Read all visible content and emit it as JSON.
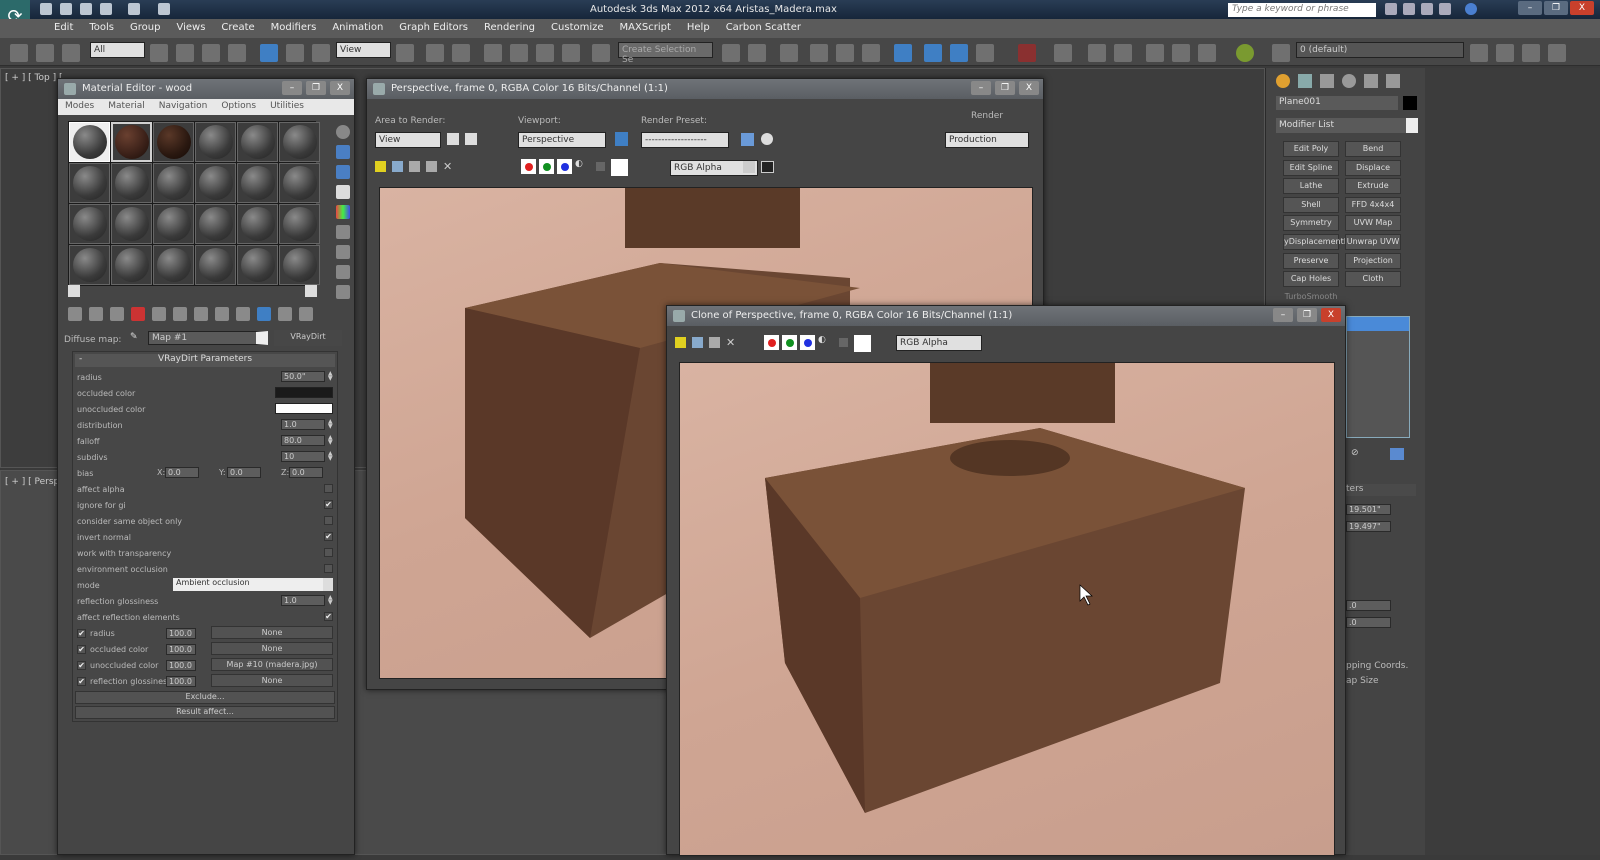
{
  "app": {
    "title": "Autodesk 3ds Max  2012 x64    Aristas_Madera.max",
    "search_placeholder": "Type a keyword or phrase",
    "minimize": "–",
    "restore": "❐",
    "close": "X"
  },
  "menu": [
    "Edit",
    "Tools",
    "Group",
    "Views",
    "Create",
    "Modifiers",
    "Animation",
    "Graph Editors",
    "Rendering",
    "Customize",
    "MAXScript",
    "Help",
    "Carbon Scatter"
  ],
  "toolbar": {
    "selection_filter": "All",
    "ref_coord": "View",
    "named_selection": "Create Selection Se",
    "layer": "0 (default)"
  },
  "viewports": {
    "top_label": "[ + ] [ Top ] [",
    "persp_label": "[ + ] [ Perspe"
  },
  "material_editor": {
    "title": "Material Editor - wood",
    "menu": [
      "Modes",
      "Material",
      "Navigation",
      "Options",
      "Utilities"
    ],
    "diffuse_label": "Diffuse map:",
    "map_name": "Map #1",
    "map_type": "VRayDirt",
    "rollout_title": "VRayDirt Parameters",
    "rollout_toggle": "-",
    "params": [
      {
        "label": "radius",
        "type": "spin",
        "value": "50.0\""
      },
      {
        "label": "occluded color",
        "type": "color",
        "color": "#1a1a1a"
      },
      {
        "label": "unoccluded color",
        "type": "color",
        "color": "#ffffff"
      },
      {
        "label": "distribution",
        "type": "spin",
        "value": "1.0"
      },
      {
        "label": "falloff",
        "type": "spin",
        "value": "80.0"
      },
      {
        "label": "subdivs",
        "type": "spin",
        "value": "10"
      },
      {
        "label": "bias",
        "type": "bias",
        "x": "0.0",
        "y": "0.0",
        "z": "0.0"
      },
      {
        "label": "affect alpha",
        "type": "check",
        "checked": false
      },
      {
        "label": "ignore for gi",
        "type": "check",
        "checked": true
      },
      {
        "label": "consider same object only",
        "type": "check",
        "checked": false
      },
      {
        "label": "invert normal",
        "type": "check",
        "checked": true
      },
      {
        "label": "work with transparency",
        "type": "check",
        "checked": false
      },
      {
        "label": "environment occlusion",
        "type": "check",
        "checked": false
      },
      {
        "label": "mode",
        "type": "select",
        "value": "Ambient occlusion"
      },
      {
        "label": "reflection glossiness",
        "type": "spin",
        "value": "1.0"
      },
      {
        "label": "affect reflection elements",
        "type": "check",
        "checked": true
      }
    ],
    "maps": [
      {
        "label": "radius",
        "amount": "100.0",
        "map": "None"
      },
      {
        "label": "occluded color",
        "amount": "100.0",
        "map": "None"
      },
      {
        "label": "unoccluded color",
        "amount": "100.0",
        "map": "Map #10 (madera.jpg)"
      },
      {
        "label": "reflection glossines",
        "amount": "100.0",
        "map": "None"
      }
    ],
    "exclude": "Exclude...",
    "result_affect": "Result affect..."
  },
  "render_window": {
    "title": "Perspective, frame 0, RGBA Color 16 Bits/Channel (1:1)",
    "area_label": "Area to Render:",
    "area_value": "View",
    "viewport_label": "Viewport:",
    "viewport_value": "Perspective",
    "preset_label": "Render Preset:",
    "preset_value": "-------------------",
    "render_label": "Render",
    "render_value": "Production",
    "channel": "RGB Alpha"
  },
  "clone_window": {
    "title": "Clone of Perspective, frame 0, RGBA Color 16 Bits/Channel (1:1)",
    "channel": "RGB Alpha"
  },
  "command_panel": {
    "object_name": "Plane001",
    "modifier_list": "Modifier List",
    "modifiers": [
      "Edit Poly",
      "Bend",
      "Edit Spline",
      "Displace",
      "Lathe",
      "Extrude",
      "Shell",
      "FFD 4x4x4",
      "Symmetry",
      "UVW Map",
      "yDisplacementI",
      "Unwrap UVW",
      "Preserve",
      "Projection",
      "Cap Holes",
      "Cloth",
      "TurboSmooth"
    ],
    "params_header": "ters",
    "length": "19.501\"",
    "width": "19.497\"",
    "val1": ".0",
    "val2": ".0",
    "mapping": "pping Coords.",
    "mapsize": "ap Size"
  }
}
